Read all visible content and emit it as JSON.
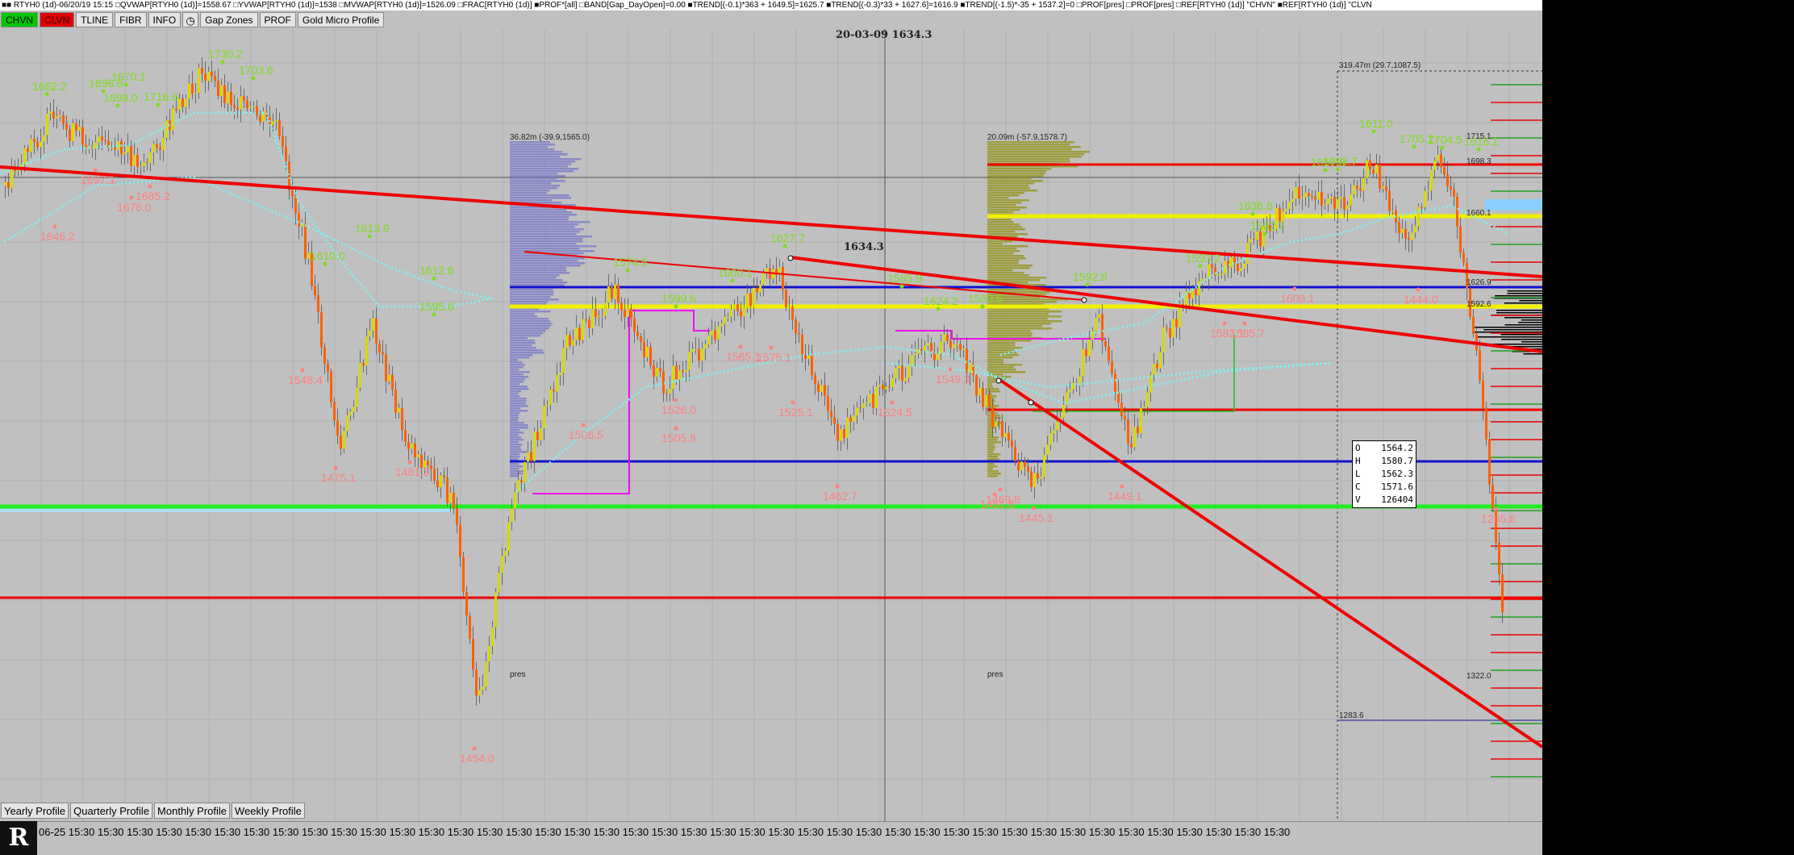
{
  "title_strip": "■■ RTYH0 (1d)-06/20/19 15:15 □QVWAP[RTYH0 (1d)]=1558.67 □YVWAP[RTYH0 (1d)]=1538 □MVWAP[RTYH0 (1d)]=1526.09 □FRAC[RTYH0 (1d)] ■PROF*[all] □BAND[Gap_DayOpen]=0.00 ■TREND[(-0.1)*363 + 1649.5]=1625.7 ■TREND[(-0.3)*33 + 1627.6]=1616.9 ■TREND[(-1.5)*-35 + 1537.2]=0 □PROF[pres] □PROF[pres] □REF[RTYH0 (1d)] \"CHVN\" ■REF[RTYH0 (1d)] \"CLVN",
  "toolbar": {
    "chvn": "CHVN",
    "clvn": "CLVN",
    "tline": "TLINE",
    "fibr": "FIBR",
    "info": "INFO",
    "clock_icon": "clock-icon",
    "gap_zones": "Gap Zones",
    "prof": "PROF",
    "gold_micro": "Gold Micro Profile"
  },
  "crosshair": {
    "date": "20-03-09",
    "price": "1634.3"
  },
  "profiles": {
    "p1_header": "36.82m (-39.9,1565.0)",
    "p2_header": "20.09m (-57.9,1578.7)",
    "p3_header": "319.47m (29.7,1087.5)",
    "p1_label": "pres",
    "p2_label": "pres"
  },
  "fractal_highs": [
    "1662.2",
    "1730.2",
    "1703.6",
    "1699.0",
    "1716.6",
    "1698.6",
    "1670.1",
    "1610.0",
    "1613.9",
    "1595.6",
    "1612.6",
    "1574.5",
    "1599.6",
    "1600.1",
    "1627.7",
    "1585.9",
    "1624.2",
    "1583.6",
    "1592.8",
    "1593.2",
    "1592.7",
    "1636.8",
    "1657.8",
    "1611.0",
    "1705.2",
    "1704.5",
    "1693.7",
    "1616.1"
  ],
  "fractal_lows": [
    "1697.1",
    "1676.0",
    "1685.2",
    "1646.2",
    "1548.4",
    "1475.1",
    "1481.3",
    "1506.5",
    "1526.0",
    "1505.8",
    "1565.1",
    "1575.1",
    "1525.1",
    "1524.5",
    "1549.3",
    "1462.7",
    "1469.8",
    "1445.1",
    "1449.1",
    "1582.1",
    "1585.7",
    "1609.1",
    "1444.0",
    "1265.6",
    "1454.0",
    "1461.6"
  ],
  "right_axis": [
    "1715.1",
    "1698.3",
    "1660.1",
    "1626.9",
    "1592.6",
    "1322.0",
    "1283.6"
  ],
  "ohlc": {
    "o_label": "O",
    "o_value": "1564.2",
    "h_label": "H",
    "h_value": "1580.7",
    "l_label": "L",
    "l_value": "1562.3",
    "c_label": "C",
    "c_value": "1571.6",
    "v_label": "V",
    "v_value": "126404"
  },
  "period_tabs": [
    "Yearly Profile",
    "Quarterly Profile",
    "Monthly Profile",
    "Weekly Profile"
  ],
  "time_axis": {
    "first": "06-25",
    "tick": "15:30",
    "tick_count": 42
  },
  "logo_text": "R",
  "colors": {
    "background": "#c0c0c0",
    "candle_up": "#d8d800",
    "candle_down": "#ff6000",
    "vwap": "#7ff0f0",
    "fractal_high": "#7fdc20",
    "fractal_low": "#ff8080",
    "trend_red": "#ee0000",
    "level_blue": "#1010d0",
    "level_green": "#20ee20",
    "level_yellow": "#f0f000",
    "magenta": "#ee10ee",
    "profile1": "#8080c8",
    "profile2": "#9a9a30"
  }
}
